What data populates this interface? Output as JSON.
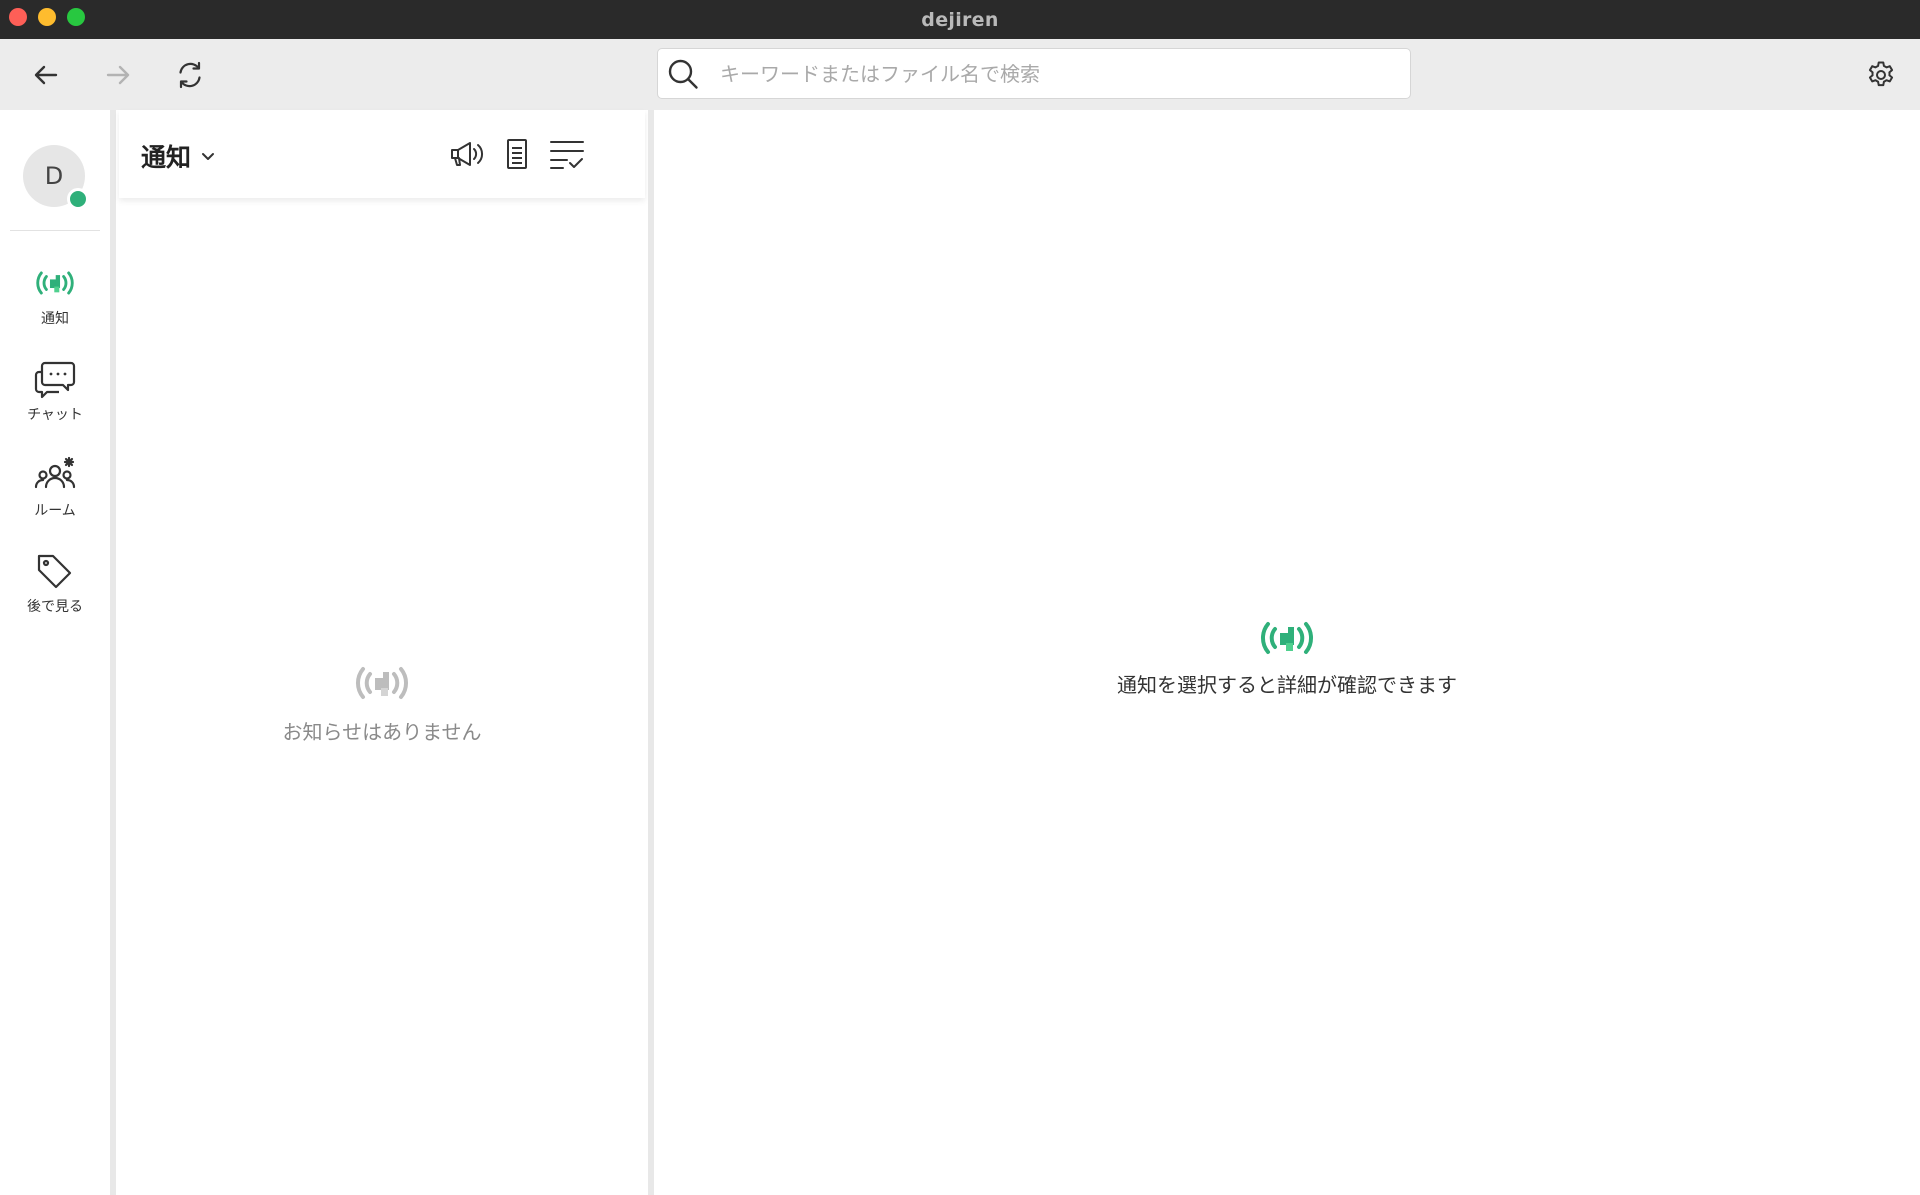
{
  "window": {
    "title": "dejiren"
  },
  "toolbar": {
    "search_placeholder": "キーワードまたはファイル名で検索",
    "back_icon": "arrow-left-icon",
    "forward_icon": "arrow-right-icon",
    "reload_icon": "refresh-icon",
    "settings_icon": "gear-icon"
  },
  "user": {
    "avatar_initial": "D",
    "status_color": "#2fb07a"
  },
  "nav": {
    "items": [
      {
        "label": "通知",
        "icon": "notification-broadcast-icon"
      },
      {
        "label": "チャット",
        "icon": "chat-bubbles-icon"
      },
      {
        "label": "ルーム",
        "icon": "room-people-icon"
      },
      {
        "label": "後で見る",
        "icon": "tag-icon"
      }
    ]
  },
  "list": {
    "title": "通知",
    "empty_message": "お知らせはありません",
    "header_icons": [
      "megaphone-icon",
      "document-icon",
      "checklist-icon"
    ]
  },
  "detail": {
    "empty_message": "通知を選択すると詳細が確認できます"
  },
  "colors": {
    "accent": "#2fb07a",
    "accent_light": "#4fd08e",
    "muted_icon": "#bdbdbd"
  }
}
